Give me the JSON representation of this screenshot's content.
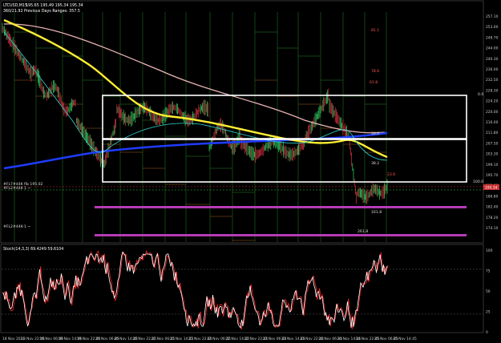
{
  "header": {
    "symbol": "LTCUSD,M15",
    "ohlc": "195.65 195.49 195.34 195.34",
    "info_line": "360/21.92   Previous Days Ranges: 357.5"
  },
  "price_axis": {
    "labels": [
      "257.10",
      "253.00",
      "248.70",
      "244.00",
      "240.30",
      "236.00",
      "232.50",
      "228.30",
      "224.20",
      "220.00",
      "216.00",
      "211.80",
      "207.50",
      "203.30",
      "199.10",
      "195.70",
      "191.00",
      "186.80",
      "182.40",
      "178.20",
      "174.10"
    ],
    "current_price": "195.34"
  },
  "stoch_axis": {
    "labels": [
      "100",
      "75",
      "50",
      "25",
      "0"
    ]
  },
  "time_axis": {
    "labels": [
      "18 Nov 2021",
      "18 Nov 22:45",
      "19 Nov 06:45",
      "19 Nov 14:45",
      "19 Nov 22:45",
      "20 Nov 06:45",
      "20 Nov 14:45",
      "20 Nov 22:45",
      "21 Nov 06:45",
      "21 Nov 14:45",
      "21 Nov 22:45",
      "22 Nov 06:45",
      "22 Nov 14:45",
      "22 Nov 22:45",
      "23 Nov 06:45",
      "23 Nov 14:45",
      "23 Nov 22:45",
      "24 Nov 06:45",
      "24 Nov 14:45",
      "24 Nov 22:45",
      "25 Nov 06:45",
      "25 Nov 14:45"
    ]
  },
  "subwindow": {
    "title": "Stoch(14,3,3) 69.4249 59.6104"
  },
  "annotations": {
    "fib_left": [
      "#FL7#44K fib 195.02",
      "#FL2#44K 1 ~",
      "#FL2#44K-1 ~"
    ],
    "fib_levels": [
      "81.1",
      "78.6",
      "61.8",
      "50.0",
      "38.2",
      "23.6",
      "0.0",
      "100.0",
      "161.8",
      "261.8"
    ]
  },
  "colors": {
    "ma_yellow": "#ffee33",
    "ma_blue": "#1f3cff",
    "ma_pink": "#e8b4b4",
    "box": "#ffffff",
    "band_purple": "#b53cb5",
    "stoch_main": "#ffffff",
    "stoch_signal": "#ff2222"
  }
}
